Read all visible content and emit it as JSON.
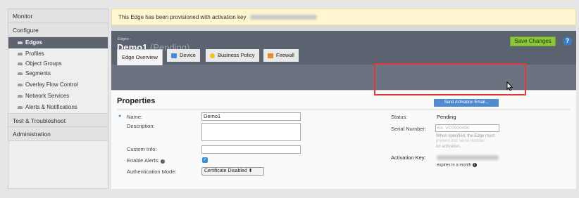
{
  "sidebar": {
    "sections": [
      "Monitor",
      "Configure",
      "Test & Troubleshoot",
      "Administration"
    ],
    "items": [
      {
        "label": "Edges",
        "icon": "cloud-icon",
        "active": true
      },
      {
        "label": "Profiles",
        "icon": "cloud-icon"
      },
      {
        "label": "Object Groups",
        "icon": "cloud-icon"
      },
      {
        "label": "Segments",
        "icon": "cloud-icon"
      },
      {
        "label": "Overlay Flow Control",
        "icon": "cloud-icon"
      },
      {
        "label": "Network Services",
        "icon": "cloud-icon"
      },
      {
        "label": "Alerts & Notifications",
        "icon": "cloud-icon"
      }
    ]
  },
  "banner": {
    "text": "This Edge has been provisioned with activation key"
  },
  "header": {
    "breadcrumb": "Edges -",
    "title": "Demo1",
    "status": "(Pending)",
    "save_label": "Save Changes",
    "help_label": "?"
  },
  "tabs": [
    {
      "label": "Edge Overview",
      "active": true
    },
    {
      "label": "Device",
      "icon": "wrench-icon"
    },
    {
      "label": "Business Policy",
      "icon": "person-icon"
    },
    {
      "label": "Firewall",
      "icon": "house-icon"
    }
  ],
  "properties": {
    "title": "Properties",
    "name_label": "Name:",
    "name_value": "Demo1",
    "description_label": "Description:",
    "custom_info_label": "Custom Info:",
    "enable_alerts_label": "Enable Alerts:",
    "auth_mode_label": "Authentication Mode:",
    "auth_mode_value": "Certificate Disabled ⬍",
    "status_label": "Status:",
    "status_value": "Pending",
    "serial_label": "Serial Number:",
    "serial_placeholder": "Ex: VC0000490",
    "serial_hint_1": "When specified, the Edge must",
    "serial_hint_2": "present this serial number",
    "serial_hint_3": "on activation.",
    "activation_label": "Activation Key:",
    "expires_text": "expires in a month",
    "send_email_label": "Send Activation Email..."
  },
  "colors": {
    "accent": "#8cc63f",
    "header": "#5b6270",
    "highlight": "#e0393a",
    "link": "#4e8bd0"
  }
}
